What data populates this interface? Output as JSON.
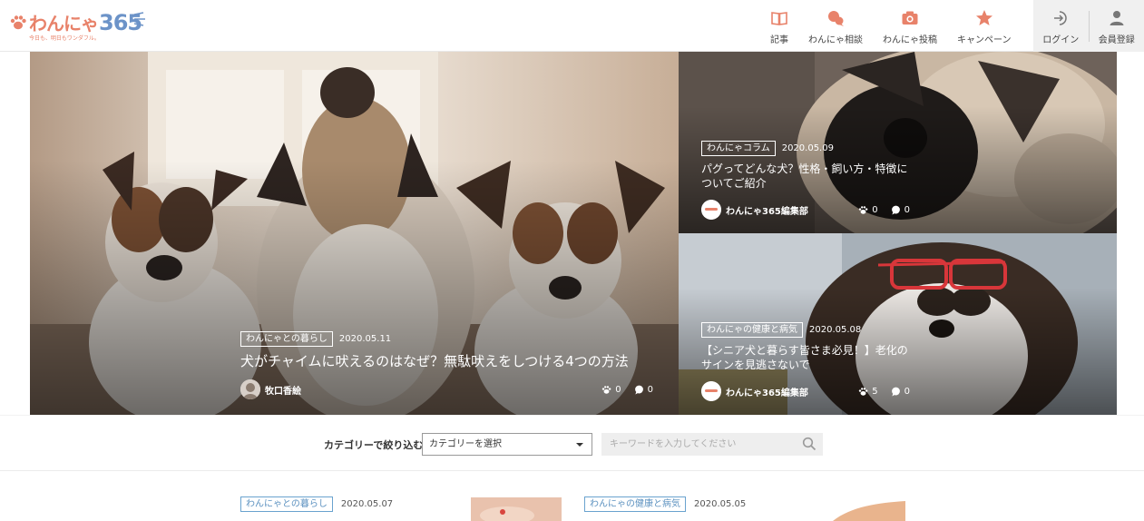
{
  "header": {
    "logo_text": "わんにゃ",
    "logo_number": "365",
    "logo_tagline": "今日も、明日もワンダフル。",
    "nav": [
      {
        "id": "articles",
        "label": "記事",
        "icon": "book-icon"
      },
      {
        "id": "consult",
        "label": "わんにゃ相談",
        "icon": "chat-bubble-icon"
      },
      {
        "id": "post",
        "label": "わんにゃ投稿",
        "icon": "camera-icon"
      },
      {
        "id": "campaign",
        "label": "キャンペーン",
        "icon": "star-icon"
      }
    ],
    "user_nav": [
      {
        "id": "login",
        "label": "ログイン",
        "icon": "login-icon"
      },
      {
        "id": "register",
        "label": "会員登録",
        "icon": "user-icon"
      }
    ]
  },
  "hero": {
    "main": {
      "category": "わんにゃとの暮らし",
      "date": "2020.05.11",
      "title": "犬がチャイムに吠えるのはなぜ？無駄吠えをしつける4つの方法",
      "author": "牧口香絵",
      "likes": "0",
      "comments": "0"
    },
    "top": {
      "category": "わんにゃコラム",
      "date": "2020.05.09",
      "title": "パグってどんな犬？性格・飼い方・特徴についてご紹介",
      "author": "わんにゃ365編集部",
      "likes": "0",
      "comments": "0"
    },
    "bottom": {
      "category": "わんにゃの健康と病気",
      "date": "2020.05.08",
      "title": "【シニア犬と暮らす皆さま必見！】老化のサインを見逃さないで",
      "author": "わんにゃ365編集部",
      "likes": "5",
      "comments": "0"
    }
  },
  "filter": {
    "label": "カテゴリーで絞り込む",
    "select_value": "カテゴリーを選択",
    "search_placeholder": "キーワードを入力してください"
  },
  "list": [
    {
      "category": "わんにゃとの暮らし",
      "date": "2020.05.07"
    },
    {
      "category": "わんにゃの健康と病気",
      "date": "2020.05.05"
    }
  ],
  "colors": {
    "brand_orange": "#e8826a",
    "brand_blue": "#6c93c8",
    "tag_blue": "#5d92c0"
  }
}
